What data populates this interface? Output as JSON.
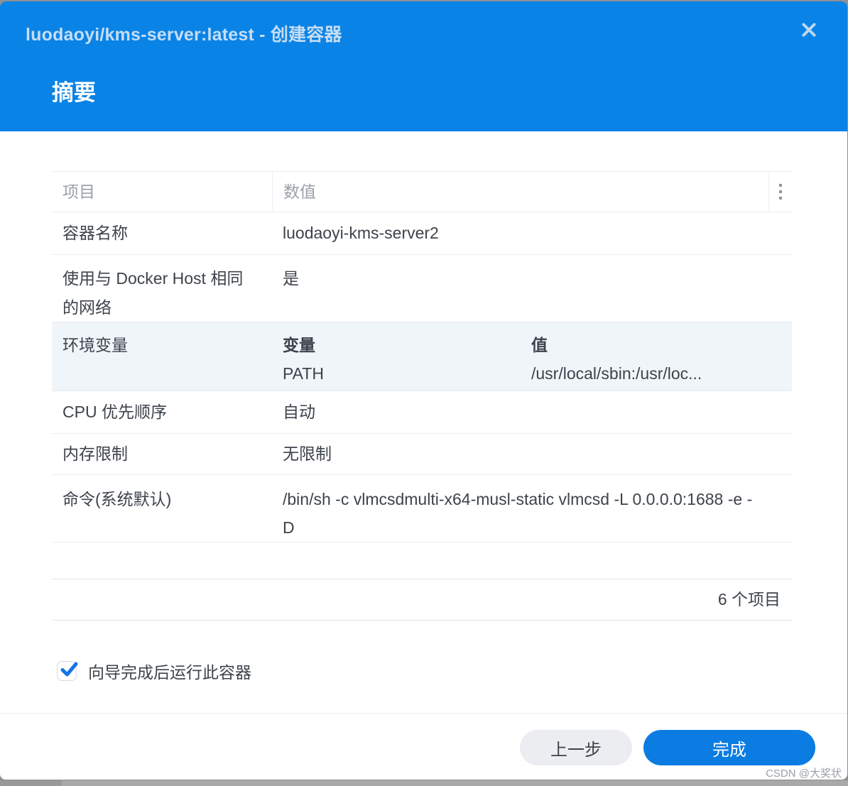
{
  "window": {
    "title": "luodaoyi/kms-server:latest - 创建容器",
    "section_title": "摘要"
  },
  "summary_table": {
    "col_item": "项目",
    "col_value": "数值",
    "rows": [
      {
        "label": "容器名称",
        "value": "luodaoyi-kms-server2"
      },
      {
        "label": "使用与 Docker Host 相同的网络",
        "value": "是"
      },
      {
        "label": "环境变量",
        "env_col_variable": "变量",
        "env_col_value": "值",
        "env_variable": "PATH",
        "env_value": "/usr/local/sbin:/usr/loc..."
      },
      {
        "label": "CPU 优先顺序",
        "value": "自动"
      },
      {
        "label": "内存限制",
        "value": "无限制"
      },
      {
        "label": "命令(系统默认)",
        "value": "/bin/sh -c vlmcsdmulti-x64-musl-static vlmcsd -L 0.0.0.0:1688 -e -D"
      }
    ],
    "items_count": "6 个项目"
  },
  "run_option": {
    "label": "向导完成后运行此容器",
    "checked": true
  },
  "actions": {
    "back": "上一步",
    "finish": "完成"
  },
  "watermark": "CSDN @大奖状",
  "colors": {
    "titlebar": "#0a83e6",
    "finish_button": "#0a7ce2",
    "highlight_row": "#f0f5fa",
    "check": "#1173e8"
  }
}
